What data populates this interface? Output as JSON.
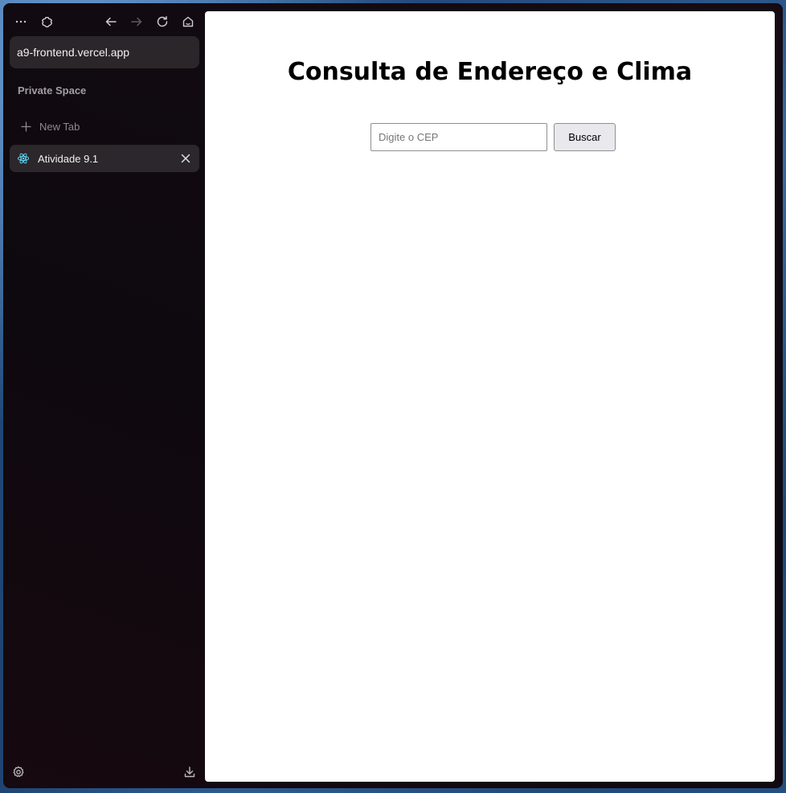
{
  "browser": {
    "toolbar": {
      "menu_icon": "more-horizontal-icon",
      "extensions_icon": "puzzle-icon",
      "back_icon": "arrow-left-icon",
      "forward_icon": "arrow-right-icon",
      "reload_icon": "reload-icon",
      "home_icon": "home-icon"
    },
    "url": "a9-frontend.vercel.app",
    "space_title": "Private Space",
    "new_tab_label": "New Tab",
    "tabs": [
      {
        "title": "Atividade 9.1",
        "favicon": "react-icon",
        "active": true
      }
    ],
    "bottom": {
      "settings_icon": "settings-icon",
      "downloads_icon": "download-icon"
    }
  },
  "page": {
    "title": "Consulta de Endereço e Clima",
    "cep_input": {
      "placeholder": "Digite o CEP",
      "value": ""
    },
    "search_button": "Buscar"
  },
  "colors": {
    "sidebar_bg": "#140b13",
    "tab_active_bg": "#2b272a",
    "url_bar_bg": "#2a2629",
    "react_accent": "#61dafb",
    "page_bg": "#ffffff",
    "button_bg": "#e9e9ed"
  }
}
